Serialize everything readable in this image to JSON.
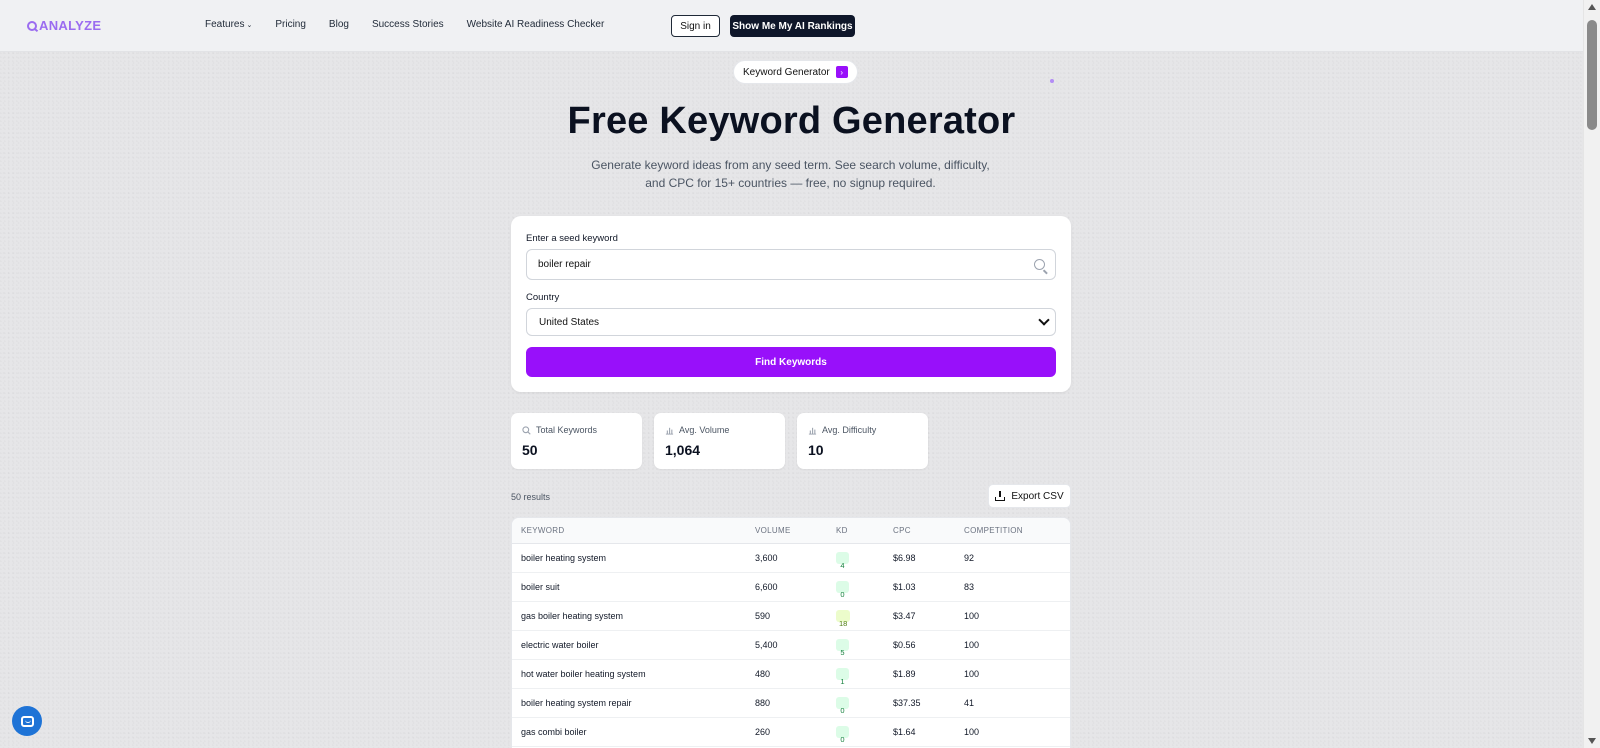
{
  "nav": {
    "logo_text": "ANALYZE",
    "links": [
      "Features",
      "Pricing",
      "Blog",
      "Success Stories",
      "Website AI Readiness Checker"
    ],
    "signin_label": "Sign in",
    "cta_label": "Show Me My AI Rankings"
  },
  "crumb": {
    "label": "Keyword Generator",
    "arrow": "›"
  },
  "hero": {
    "title": "Free Keyword Generator",
    "subtitle": "Generate keyword ideas from any seed term. See search volume, difficulty, and CPC for 15+ countries — free, no signup required."
  },
  "form": {
    "seed_label": "Enter a seed keyword",
    "seed_value": "boiler repair",
    "country_label": "Country",
    "country_value": "United States",
    "submit_label": "Find Keywords"
  },
  "stats": [
    {
      "label": "Total Keywords",
      "value": "50",
      "icon": "search-icon"
    },
    {
      "label": "Avg. Volume",
      "value": "1,064",
      "icon": "bar-chart-icon"
    },
    {
      "label": "Avg. Difficulty",
      "value": "10",
      "icon": "bar-chart-icon"
    }
  ],
  "results": {
    "count_label": "50 results",
    "export_label": "Export CSV",
    "columns": [
      "KEYWORD",
      "VOLUME",
      "KD",
      "CPC",
      "COMPETITION"
    ],
    "rows": [
      {
        "keyword": "boiler heating system",
        "volume": "3,600",
        "kd": "4",
        "cpc": "$6.98",
        "competition": "92"
      },
      {
        "keyword": "boiler suit",
        "volume": "6,600",
        "kd": "0",
        "cpc": "$1.03",
        "competition": "83"
      },
      {
        "keyword": "gas boiler heating system",
        "volume": "590",
        "kd": "18",
        "cpc": "$3.47",
        "competition": "100"
      },
      {
        "keyword": "electric water boiler",
        "volume": "5,400",
        "kd": "5",
        "cpc": "$0.56",
        "competition": "100"
      },
      {
        "keyword": "hot water boiler heating system",
        "volume": "480",
        "kd": "1",
        "cpc": "$1.89",
        "competition": "100"
      },
      {
        "keyword": "boiler heating system repair",
        "volume": "880",
        "kd": "0",
        "cpc": "$37.35",
        "competition": "41"
      },
      {
        "keyword": "gas combi boiler",
        "volume": "260",
        "kd": "0",
        "cpc": "$1.64",
        "competition": "100"
      }
    ]
  },
  "colors": {
    "accent": "#9810fa",
    "logo": "#9b6cf0",
    "kd_low_bg": "#dcfce7",
    "kd_low_fg": "#15803d",
    "kd_mid_bg": "#ecfccb",
    "kd_mid_fg": "#4d7c0f",
    "chat": "#1e73d6"
  }
}
